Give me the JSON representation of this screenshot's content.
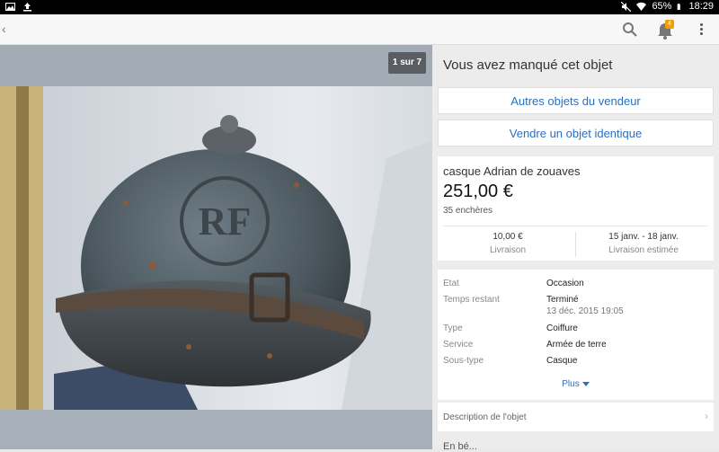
{
  "status_bar": {
    "battery": "65%",
    "time": "18:29"
  },
  "app_bar": {
    "back_icon": "chevron-left-icon",
    "notification_count": "4"
  },
  "photo": {
    "counter": "1 sur 7"
  },
  "right_panel": {
    "missed_title": "Vous avez manqué cet objet",
    "btn_seller": "Autres objets du vendeur",
    "btn_sell_same": "Vendre un objet identique",
    "item_title": "casque Adrian de zouaves",
    "price": "251,00 €",
    "bids": "35 enchères",
    "shipping_value": "10,00 €",
    "shipping_label": "Livraison",
    "delivery_value": "15 janv. - 18 janv.",
    "delivery_label": "Livraison estimée",
    "details": [
      {
        "key": "Etat",
        "value": "Occasion"
      },
      {
        "key": "Temps restant",
        "value": "Terminé",
        "sub": "13 déc. 2015 19:05"
      },
      {
        "key": "Type",
        "value": "Coiffure"
      },
      {
        "key": "Service",
        "value": "Armée de terre"
      },
      {
        "key": "Sous-type",
        "value": "Casque"
      }
    ],
    "plus_label": "Plus",
    "description_label": "Description de l'objet",
    "partial_next": "En bé..."
  },
  "colors": {
    "link_blue": "#2a6fbf",
    "badge_orange": "#f0a000"
  }
}
